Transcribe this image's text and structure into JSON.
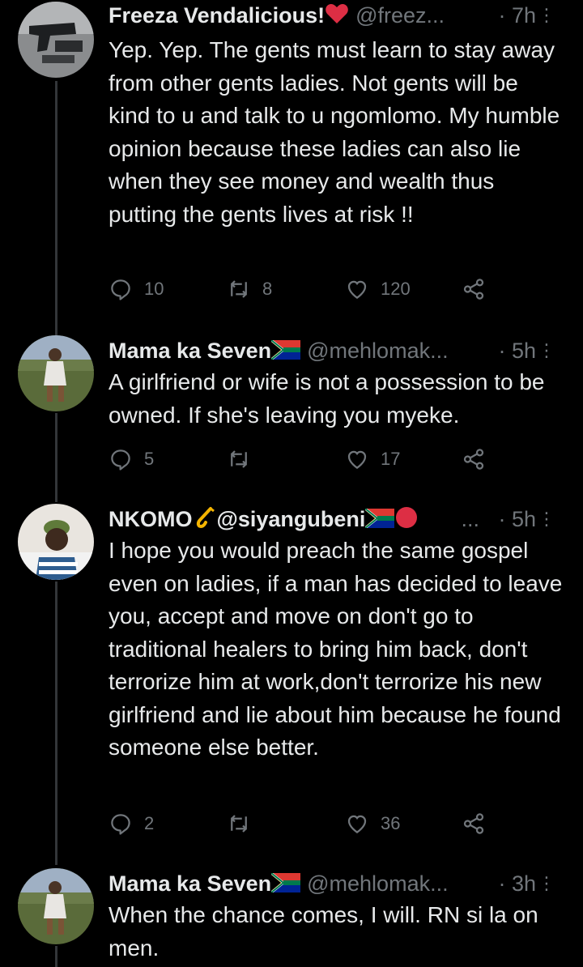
{
  "tweets": [
    {
      "name": "Freeza Vendalicious!",
      "handle": "@freez...",
      "time": "· 7h",
      "text": "Yep. Yep. The gents must learn to stay away from other gents ladies. Not gents will be kind to u and talk to u ngomlomo. My humble opinion because these ladies can also lie when they see money and wealth thus putting the gents lives at risk !!",
      "replies": "10",
      "retweets": "8",
      "likes": "120",
      "name_emoji": "heart-emoji"
    },
    {
      "name": "Mama ka Seven",
      "handle": "@mehlomak...",
      "time": "· 5h",
      "text": "A girlfriend or wife is not a possession to be owned. If she's leaving you myeke.",
      "replies": "5",
      "retweets": "",
      "likes": "17",
      "name_emoji": "south-africa-flag-emoji"
    },
    {
      "name": "NKOMO",
      "handle": "@siyangubeni",
      "ellipsis": "...",
      "time": "· 5h",
      "text": "I hope you would preach the same gospel even on ladies, if a man has decided to leave you, accept and move on don't go to traditional healers to bring him back, don't terrorize him at work,don't terrorize his new girlfriend and lie about him because he found someone else better.",
      "replies": "2",
      "retweets": "",
      "likes": "36",
      "name_emoji": "saxophone-emoji"
    },
    {
      "name": "Mama ka Seven",
      "handle": "@mehlomak...",
      "time": "· 3h",
      "text": "When the chance comes, I will. RN si la on men.",
      "name_emoji": "south-africa-flag-emoji"
    }
  ],
  "colors": {
    "background": "#000000",
    "text": "#e7e9ea",
    "muted": "#71767b",
    "thread_line": "#333639"
  }
}
